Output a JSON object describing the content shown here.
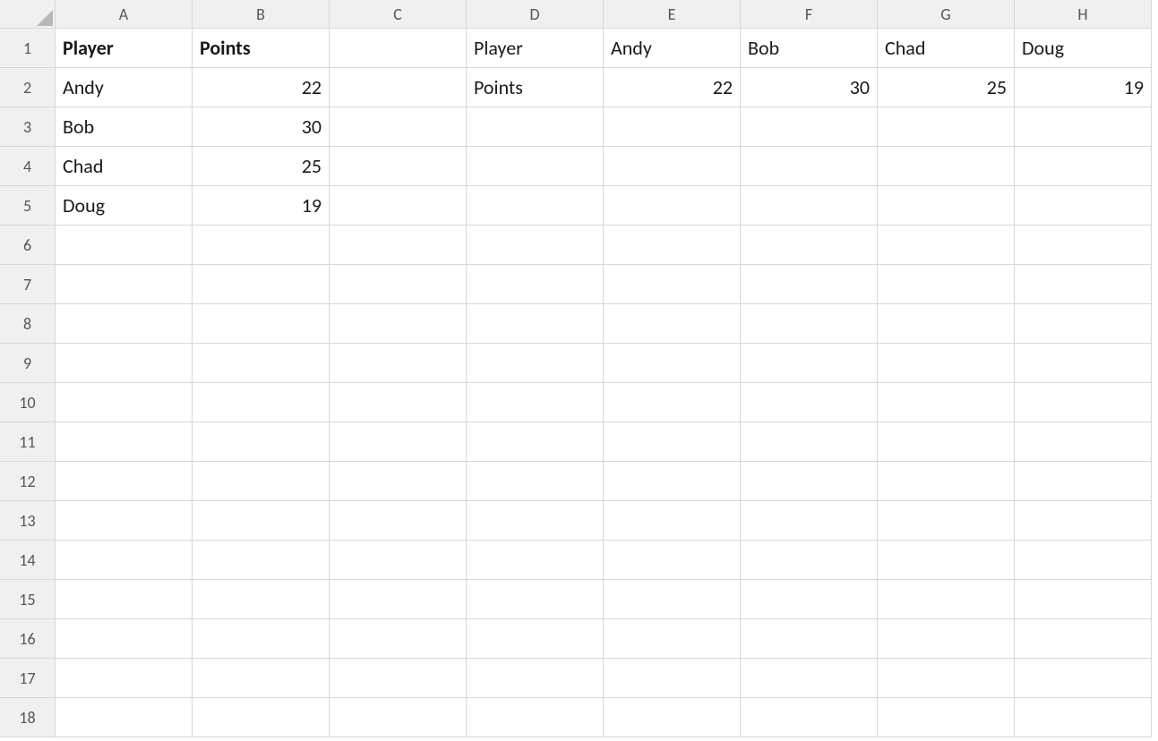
{
  "columns": [
    "A",
    "B",
    "C",
    "D",
    "E",
    "F",
    "G",
    "H"
  ],
  "rowCount": 18,
  "cells": {
    "A1": {
      "v": "Player",
      "bold": true,
      "align": "left"
    },
    "B1": {
      "v": "Points",
      "bold": true,
      "align": "left"
    },
    "A2": {
      "v": "Andy",
      "align": "left"
    },
    "B2": {
      "v": "22",
      "align": "right"
    },
    "A3": {
      "v": "Bob",
      "align": "left"
    },
    "B3": {
      "v": "30",
      "align": "right"
    },
    "A4": {
      "v": "Chad",
      "align": "left"
    },
    "B4": {
      "v": "25",
      "align": "right"
    },
    "A5": {
      "v": "Doug",
      "align": "left"
    },
    "B5": {
      "v": "19",
      "align": "right"
    },
    "D1": {
      "v": "Player",
      "align": "left"
    },
    "E1": {
      "v": "Andy",
      "align": "left"
    },
    "F1": {
      "v": "Bob",
      "align": "left"
    },
    "G1": {
      "v": "Chad",
      "align": "left"
    },
    "H1": {
      "v": "Doug",
      "align": "left"
    },
    "D2": {
      "v": "Points",
      "align": "left"
    },
    "E2": {
      "v": "22",
      "align": "right"
    },
    "F2": {
      "v": "30",
      "align": "right"
    },
    "G2": {
      "v": "25",
      "align": "right"
    },
    "H2": {
      "v": "19",
      "align": "right"
    }
  },
  "chart_data": [
    {
      "type": "table",
      "title": "Player Points (vertical)",
      "columns": [
        "Player",
        "Points"
      ],
      "rows": [
        [
          "Andy",
          22
        ],
        [
          "Bob",
          30
        ],
        [
          "Chad",
          25
        ],
        [
          "Doug",
          19
        ]
      ]
    },
    {
      "type": "table",
      "title": "Player Points (transposed)",
      "columns": [
        "Player",
        "Andy",
        "Bob",
        "Chad",
        "Doug"
      ],
      "rows": [
        [
          "Points",
          22,
          30,
          25,
          19
        ]
      ]
    }
  ]
}
